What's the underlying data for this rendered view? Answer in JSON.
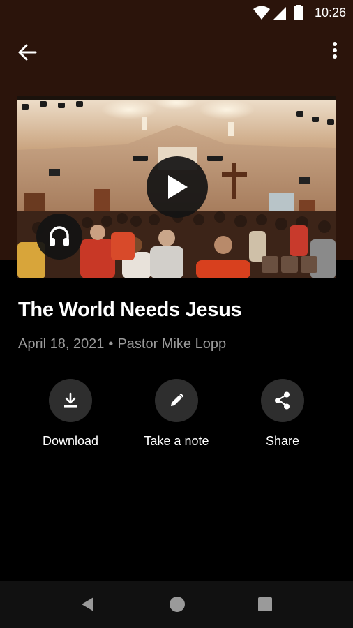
{
  "status_bar": {
    "time": "10:26",
    "icons": [
      "wifi-icon",
      "cell-signal-icon",
      "battery-icon"
    ]
  },
  "app_bar": {
    "back_icon": "arrow-back-icon",
    "menu_icon": "more-vert-icon"
  },
  "media": {
    "image": "church-worship-photo",
    "play_icon": "play-icon",
    "audio_icon": "headphones-icon"
  },
  "sermon": {
    "title": "The World Needs Jesus",
    "date": "April 18, 2021",
    "separator": "•",
    "speaker": "Pastor Mike Lopp"
  },
  "actions": [
    {
      "label": "Download",
      "icon": "download-icon"
    },
    {
      "label": "Take a note",
      "icon": "pencil-icon"
    },
    {
      "label": "Share",
      "icon": "share-icon"
    }
  ],
  "nav_bar": {
    "icons": [
      "nav-back-icon",
      "nav-home-icon",
      "nav-recents-icon"
    ]
  },
  "colors": {
    "header_bg": "#2b140b",
    "page_bg": "#000000",
    "subtitle": "#9a9a9a",
    "action_circle": "#2e2e2e"
  }
}
